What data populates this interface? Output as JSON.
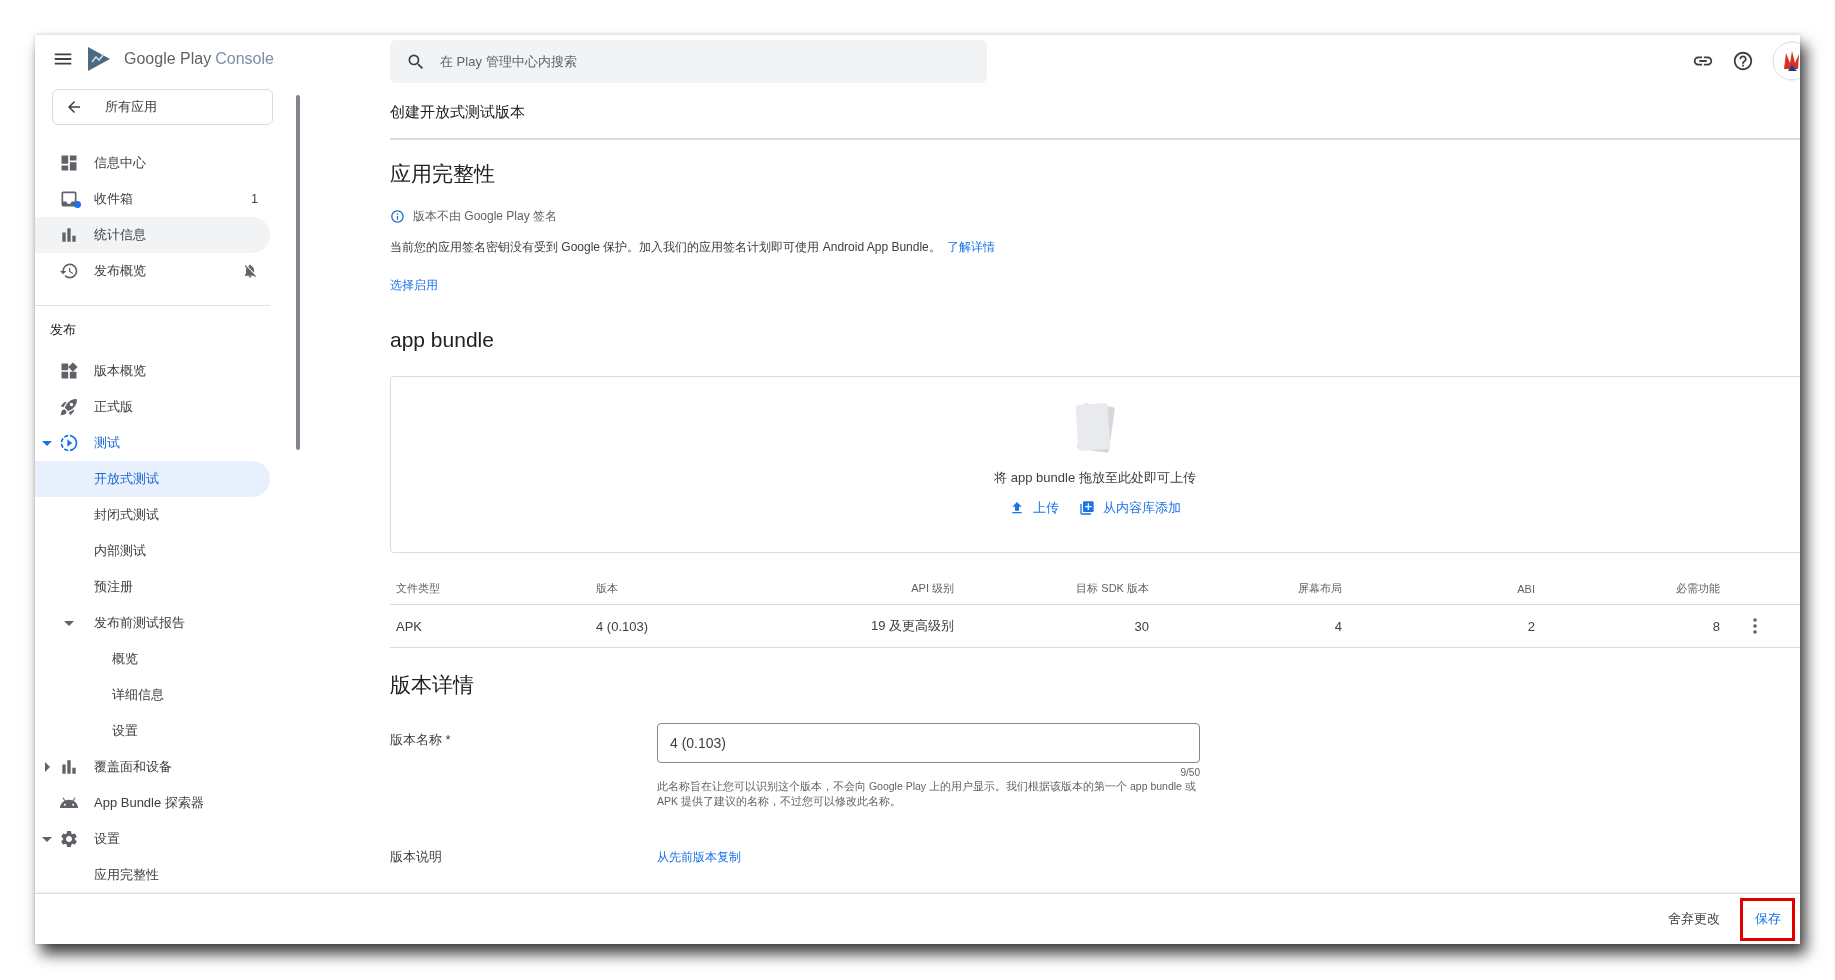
{
  "header": {
    "brand": "Google Play",
    "brand_suffix": "Console",
    "search_placeholder": "在 Play 管理中心内搜索"
  },
  "sidebar": {
    "back": "所有应用",
    "top_items": [
      {
        "label": "信息中心",
        "selected": false,
        "hovered": false,
        "muted": false
      },
      {
        "label": "收件箱",
        "selected": false,
        "hovered": false,
        "muted": false,
        "badge": "1"
      },
      {
        "label": "统计信息",
        "selected": false,
        "hovered": true,
        "muted": false
      },
      {
        "label": "发布概览",
        "selected": false,
        "hovered": false,
        "muted": true
      }
    ],
    "section": "发布",
    "nav": [
      {
        "label": "版本概览",
        "selected": false
      },
      {
        "label": "正式版",
        "selected": false
      },
      {
        "label": "测试",
        "selected": false,
        "expanded": true,
        "children": [
          {
            "label": "开放式测试",
            "selected": true
          },
          {
            "label": "封闭式测试",
            "selected": false
          },
          {
            "label": "内部测试",
            "selected": false
          },
          {
            "label": "预注册",
            "selected": false
          },
          {
            "label": "发布前测试报告",
            "selected": false,
            "expanded": true,
            "children": [
              {
                "label": "概览",
                "selected": false
              },
              {
                "label": "详细信息",
                "selected": false
              },
              {
                "label": "设置",
                "selected": false
              }
            ]
          }
        ]
      },
      {
        "label": "覆盖面和设备",
        "selected": false,
        "expanded": false
      },
      {
        "label": "App Bundle 探索器",
        "selected": false
      },
      {
        "label": "设置",
        "selected": false,
        "expanded": true,
        "children": [
          {
            "label": "应用完整性",
            "selected": false
          }
        ]
      }
    ]
  },
  "main": {
    "title": "创建开放式测试版本",
    "integrity": {
      "heading": "应用完整性",
      "notice": "版本不由 Google Play 签名",
      "description": "当前您的应用签名密钥没有受到 Google 保护。加入我们的应用签名计划即可使用 Android App Bundle。",
      "learn_more": "了解详情",
      "opt_in": "选择启用"
    },
    "bundle": {
      "heading": "app bundle",
      "drop_hint": "将 app bundle 拖放至此处即可上传",
      "upload": "上传",
      "add_from_library": "从内容库添加",
      "table": {
        "columns": [
          "文件类型",
          "版本",
          "API 级别",
          "目标 SDK 版本",
          "屏幕布局",
          "ABI",
          "必需功能"
        ],
        "rows": [
          [
            "APK",
            "4 (0.103)",
            "19 及更高级别",
            "30",
            "4",
            "2",
            "8"
          ]
        ]
      }
    },
    "details": {
      "heading": "版本详情",
      "name_label": "版本名称 *",
      "name_value": "4 (0.103)",
      "counter": "9/50",
      "help": "此名称旨在让您可以识别这个版本，不会向 Google Play 上的用户显示。我们根据该版本的第一个 app bundle 或 APK 提供了建议的名称，不过您可以修改此名称。",
      "notes_label": "版本说明",
      "copy_link": "从先前版本复制"
    }
  },
  "footer": {
    "discard": "舍弃更改",
    "save": "保存"
  }
}
